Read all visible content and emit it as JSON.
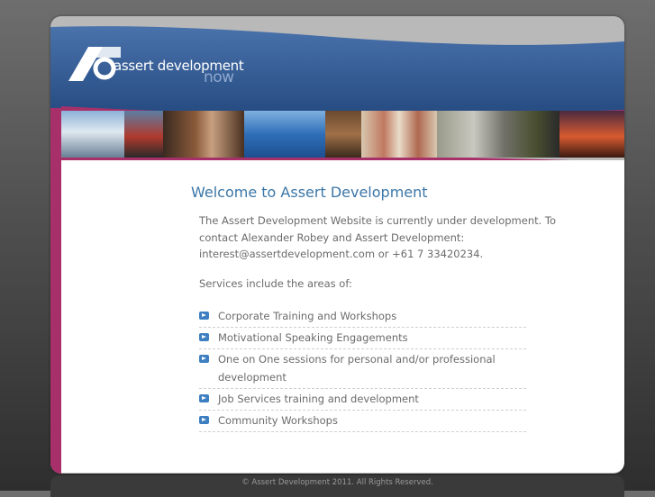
{
  "brand": {
    "name": "assert development",
    "tagline": "now",
    "logo_letters": "AD"
  },
  "main": {
    "title": "Welcome to Assert Development",
    "intro": "The Assert Development Website is currently under development. To contact Alexander Robey and Assert Development: interest@assertdevelopment.com or +61 7 33420234.",
    "services_label": "Services include the areas of:",
    "services": [
      "Corporate Training and Workshops",
      "Motivational Speaking Engagements",
      "One on One sessions for personal and/or professional development",
      "Job Services training and development",
      "Community Workshops"
    ]
  },
  "footer": {
    "copyright": "© Assert Development 2011. All Rights Reserved."
  },
  "colors": {
    "header_blue": "#2f5a93",
    "accent_magenta": "#a8306a",
    "title_blue": "#3a76a8",
    "bullet_blue": "#3d7fc1"
  }
}
